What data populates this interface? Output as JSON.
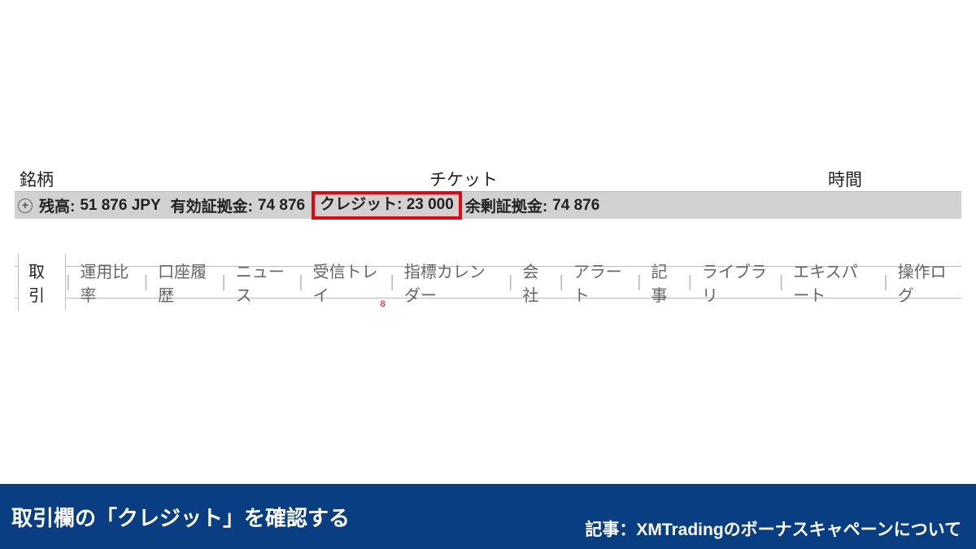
{
  "columns": {
    "symbol": "銘柄",
    "ticket": "チケット",
    "time": "時間"
  },
  "account": {
    "balance_label": "残高:",
    "balance_value": "51 876 JPY",
    "equity_label": "有効証拠金:",
    "equity_value": "74 876",
    "credit_label": "クレジット:",
    "credit_value": "23 000",
    "free_margin_label": "余剰証拠金:",
    "free_margin_value": "74 876"
  },
  "tabs": {
    "trade": "取引",
    "ratio": "運用比率",
    "history": "口座履歴",
    "news": "ニュース",
    "inbox": "受信トレイ",
    "inbox_badge": "8",
    "calendar": "指標カレンダー",
    "company": "会社",
    "alert": "アラート",
    "article": "記事",
    "library": "ライブラリ",
    "expert": "エキスパート",
    "log": "操作ログ"
  },
  "caption": {
    "left": "取引欄の「クレジット」を確認する",
    "right": "記事：XMTradingのボーナスキャペーンについて"
  }
}
